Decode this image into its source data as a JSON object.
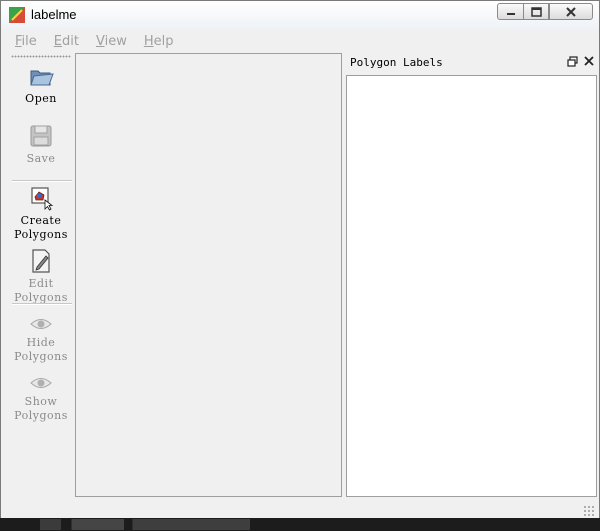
{
  "window": {
    "title": "labelme"
  },
  "menu": {
    "items": [
      {
        "mnemonic": "F",
        "rest": "ile"
      },
      {
        "mnemonic": "E",
        "rest": "dit"
      },
      {
        "mnemonic": "V",
        "rest": "iew"
      },
      {
        "mnemonic": "H",
        "rest": "elp"
      }
    ]
  },
  "toolbar": {
    "open": {
      "line1": "Open",
      "icon": "folder-open-icon"
    },
    "save": {
      "line1": "Save",
      "icon": "floppy-disk-icon"
    },
    "create": {
      "line1": "Create",
      "line2": "Polygons",
      "icon": "create-polygon-icon"
    },
    "edit": {
      "line1": "Edit",
      "line2": "Polygons",
      "icon": "edit-page-icon"
    },
    "hide": {
      "line1": "Hide",
      "line2": "Polygons",
      "icon": "eye-icon"
    },
    "show": {
      "line1": "Show",
      "line2": "Polygons",
      "icon": "eye-icon"
    }
  },
  "dock": {
    "title": "Polygon Labels",
    "items": []
  },
  "colors": {
    "disabled_text": "#8a8a8a",
    "list_bg": "#ffffff"
  }
}
